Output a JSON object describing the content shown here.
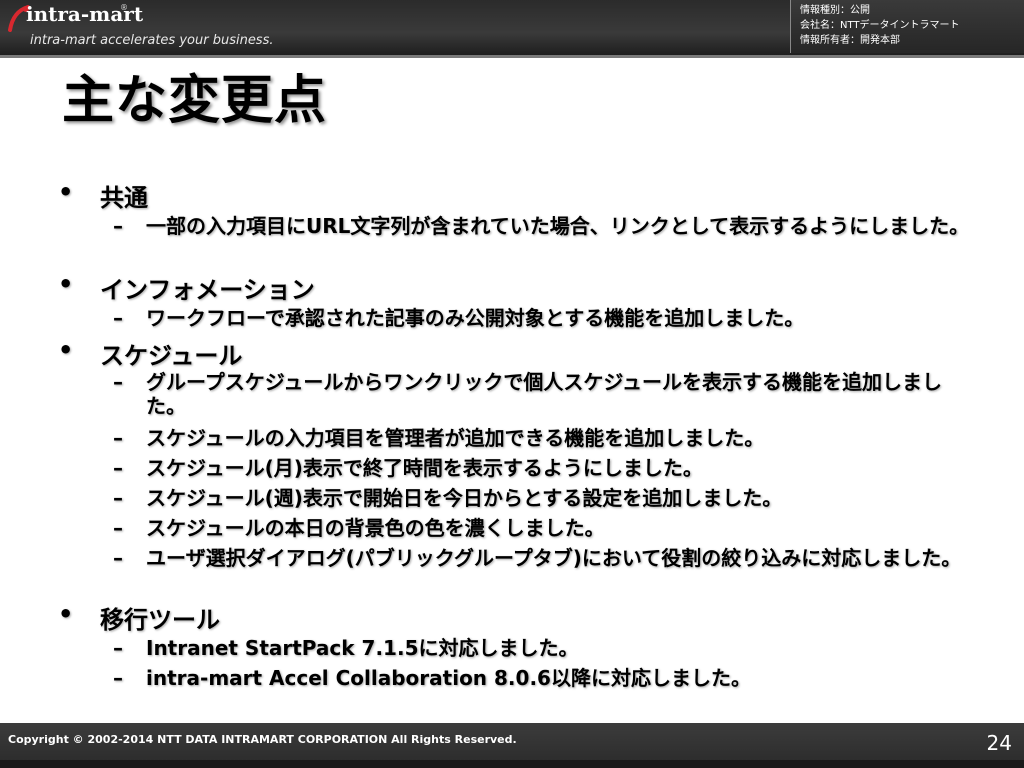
{
  "header": {
    "logo_text": "intra-mart",
    "logo_mark": "®",
    "tagline": "intra-mart accelerates your business.",
    "info": [
      "情報種別：公開",
      "会社名：NTTデータイントラマート",
      "情報所有者：開発本部"
    ]
  },
  "slide": {
    "title": "主な変更点",
    "bullet_mark": "•",
    "dash_mark": "–",
    "sections": [
      {
        "heading": "共通",
        "items": [
          "一部の入力項目にURL文字列が含まれていた場合、リンクとして表示するようにしました。"
        ]
      },
      {
        "heading": "インフォメーション",
        "items": [
          "ワークフローで承認された記事のみ公開対象とする機能を追加しました。"
        ]
      },
      {
        "heading": "スケジュール",
        "items": [
          "グループスケジュールからワンクリックで個人スケジュールを表示する機能を追加しました。",
          "スケジュールの入力項目を管理者が追加できる機能を追加しました。",
          "スケジュール(月)表示で終了時間を表示するようにしました。",
          "スケジュール(週)表示で開始日を今日からとする設定を追加しました。",
          "スケジュールの本日の背景色の色を濃くしました。",
          "ユーザ選択ダイアログ(パブリックグループタブ)において役割の絞り込みに対応しました。"
        ]
      },
      {
        "heading": "移行ツール",
        "items": [
          "Intranet StartPack 7.1.5に対応しました。",
          "intra-mart Accel Collaboration 8.0.6以降に対応しました。"
        ]
      }
    ]
  },
  "footer": {
    "copyright": "Copyright © 2002-2014 NTT DATA INTRAMART CORPORATION All Rights Reserved.",
    "page_number": "24"
  }
}
